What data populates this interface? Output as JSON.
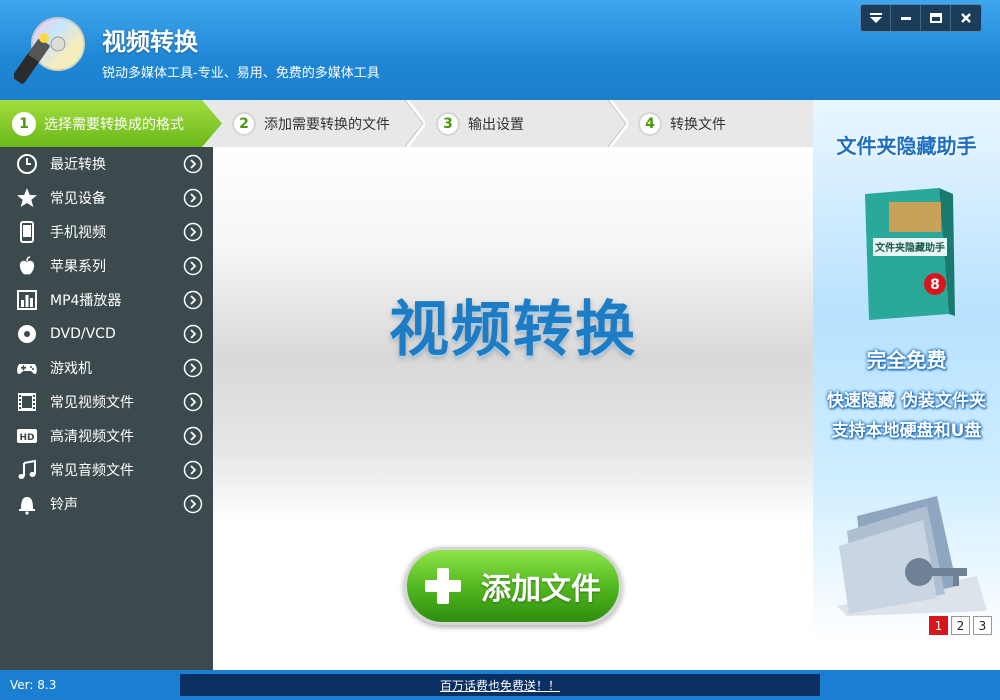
{
  "app": {
    "title": "视频转换",
    "subtitle": "锐动多媒体工具-专业、易用、免费的多媒体工具"
  },
  "window_controls": [
    "menu-icon",
    "minimize-icon",
    "maximize-icon",
    "close-icon"
  ],
  "steps": [
    {
      "num": "1",
      "label": "选择需要转换成的格式",
      "active": true
    },
    {
      "num": "2",
      "label": "添加需要转换的文件",
      "active": false
    },
    {
      "num": "3",
      "label": "输出设置",
      "active": false
    },
    {
      "num": "4",
      "label": "转换文件",
      "active": false
    }
  ],
  "sidebar": {
    "items": [
      {
        "label": "最近转换",
        "icon": "clock-icon"
      },
      {
        "label": "常见设备",
        "icon": "star-icon"
      },
      {
        "label": "手机视频",
        "icon": "phone-icon"
      },
      {
        "label": "苹果系列",
        "icon": "apple-icon"
      },
      {
        "label": "MP4播放器",
        "icon": "mp4-player-icon"
      },
      {
        "label": "DVD/VCD",
        "icon": "disc-icon"
      },
      {
        "label": "游戏机",
        "icon": "gamepad-icon"
      },
      {
        "label": "常见视频文件",
        "icon": "film-icon"
      },
      {
        "label": "高清视频文件",
        "icon": "hd-icon"
      },
      {
        "label": "常见音频文件",
        "icon": "music-note-icon"
      },
      {
        "label": "铃声",
        "icon": "bell-icon"
      }
    ]
  },
  "main": {
    "big_title": "视频转换",
    "add_button": "添加文件"
  },
  "ad": {
    "title": "文件夹隐藏助手",
    "box_label": "文件夹隐藏助手",
    "box_version": "8",
    "free": "完全免费",
    "line1": "快速隐藏 伪装文件夹",
    "line2": "支持本地硬盘和U盘",
    "pages": [
      "1",
      "2",
      "3"
    ],
    "active_page": "1"
  },
  "status": {
    "version": "Ver: 8.3",
    "marquee": "百万话费也免费送！！"
  },
  "colors": {
    "header": "#1f86d6",
    "sidebar": "#3d4a4d",
    "active_step": "#6bb81a",
    "add_button": "#4fb51c",
    "big_title": "#1d7cc4"
  }
}
